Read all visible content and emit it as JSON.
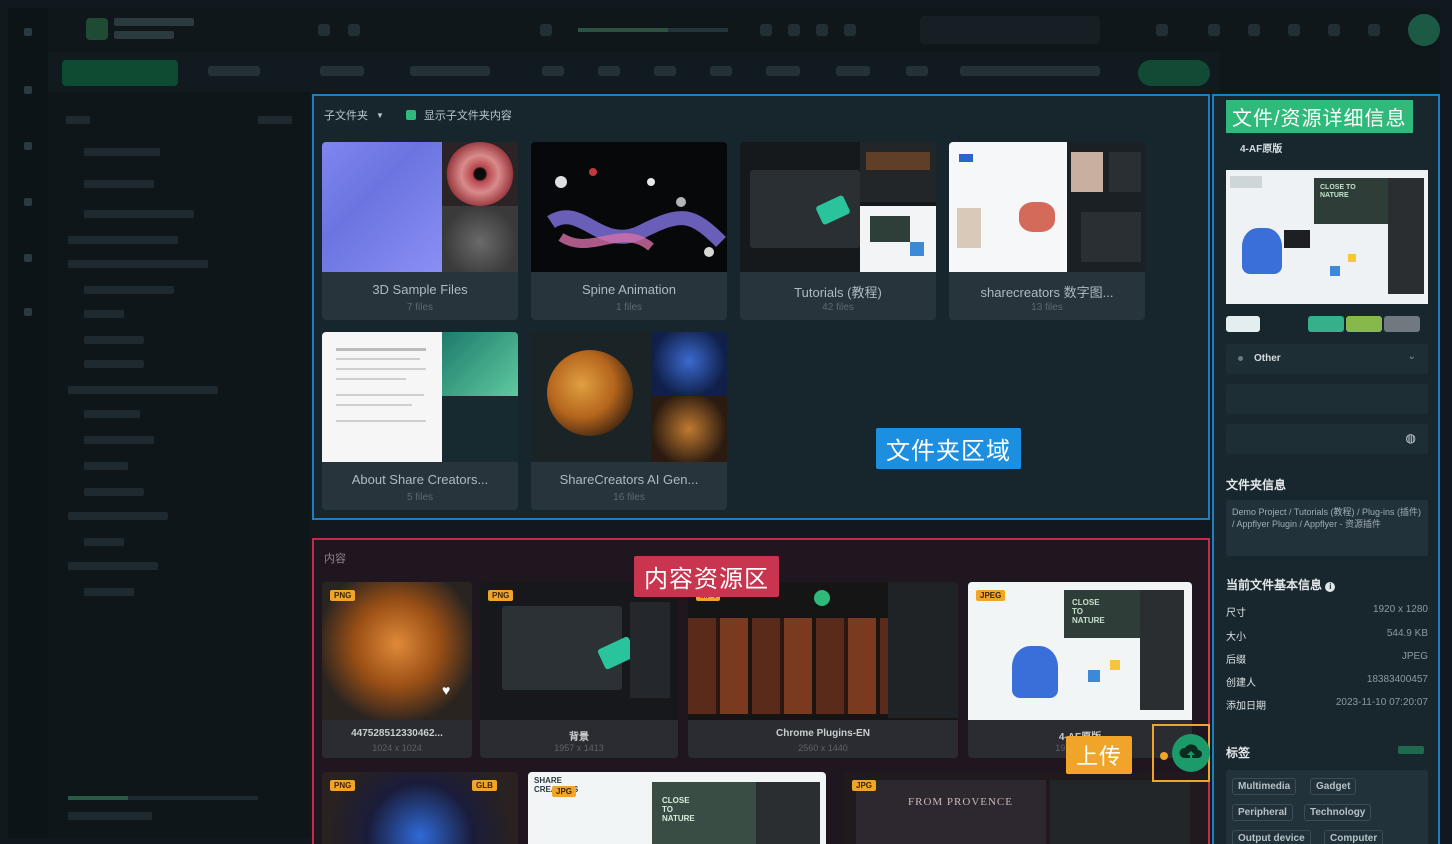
{
  "folder_area": {
    "toolbar": {
      "subfolder_label": "子文件夹",
      "show_sub_label": "显示子文件夹内容"
    },
    "region_tag": "文件夹区域",
    "folders": [
      {
        "name": "3D Sample Files",
        "count": "7  files"
      },
      {
        "name": "Spine Animation",
        "count": "1  files"
      },
      {
        "name": "Tutorials (教程)",
        "count": "42  files"
      },
      {
        "name": "sharecreators 数字图...",
        "count": "13  files"
      },
      {
        "name": "About Share Creators...",
        "count": "5  files"
      },
      {
        "name": "ShareCreators AI Gen...",
        "count": "16  files"
      }
    ]
  },
  "content_area": {
    "label": "内容",
    "region_tag": "内容资源区",
    "assets": [
      {
        "badge": "PNG",
        "name": "447528512330462...",
        "dims": "1024 x 1024"
      },
      {
        "badge": "PNG",
        "name": "背景",
        "dims": "1957 x 1413"
      },
      {
        "badge": "MP4",
        "name": "Chrome Plugins-EN",
        "dims": "2560 x 1440"
      },
      {
        "badge": "JPEG",
        "name": "4-AF原版",
        "dims": "1920 x 1280"
      },
      {
        "badge": "PNG",
        "badge2": "GLB",
        "name": "",
        "dims": ""
      },
      {
        "badge": "JPG",
        "name": "",
        "dims": ""
      },
      {
        "badge": "JPG",
        "name": "",
        "dims": ""
      }
    ],
    "thumb_texts": {
      "share": "SHARE",
      "creators": "CREATORS",
      "close_to_nature": "CLOSE TO NATURE",
      "provence": "FROM PROVENCE"
    },
    "upload_tag": "上传"
  },
  "details": {
    "title": "文件/资源详细信息",
    "filename": "4-AF原版",
    "category": "Other",
    "folder_info_title": "文件夹信息",
    "folder_path": "Demo Project / Tutorials (教程) / Plug-ins (插件) / Appflyer Plugin / Appflyer - 资源插件",
    "basic_info_title": "当前文件基本信息",
    "info": [
      {
        "k": "尺寸",
        "v": "1920 x 1280"
      },
      {
        "k": "大小",
        "v": "544.9 KB"
      },
      {
        "k": "后缀",
        "v": "JPEG"
      },
      {
        "k": "创建人",
        "v": "18383400457"
      },
      {
        "k": "添加日期",
        "v": "2023-11-10 07:20:07"
      }
    ],
    "tags_title": "标签",
    "tags": [
      "Multimedia",
      "Gadget",
      "Peripheral",
      "Technology",
      "Output device",
      "Computer"
    ]
  },
  "colors": {
    "accent_green": "#2fb97a",
    "folder_border": "#1d7fbf",
    "content_border": "#c52c4a",
    "badge_orange": "#f0a52a"
  }
}
